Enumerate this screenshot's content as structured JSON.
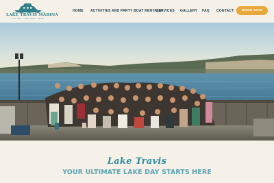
{
  "brand": {
    "name": "LAKE TRAVIS MARINA",
    "tagline": "EST. 1989 · LAKE TRAVIS, TEXAS",
    "logo_icon": "boat-logo-icon",
    "color_primary": "#2f7f8a"
  },
  "nav": {
    "items": [
      {
        "label": "HOME"
      },
      {
        "label": "ACTIVITIES AND PARTY BOAT RENTALS"
      },
      {
        "label": "SERVICES"
      },
      {
        "label": "GALLERY"
      },
      {
        "label": "FAQ"
      },
      {
        "label": "CONTACT"
      }
    ],
    "cta_label": "BOOK NOW",
    "cta_color": "#e8a93a"
  },
  "hero": {
    "image_subject": "group-photo-on-dock"
  },
  "intro": {
    "script_title": "Lake Travis",
    "tagline": "YOUR ULTIMATE LAKE DAY STARTS HERE",
    "title_color": "#2f8da0",
    "tagline_color": "#5aa4b5"
  }
}
